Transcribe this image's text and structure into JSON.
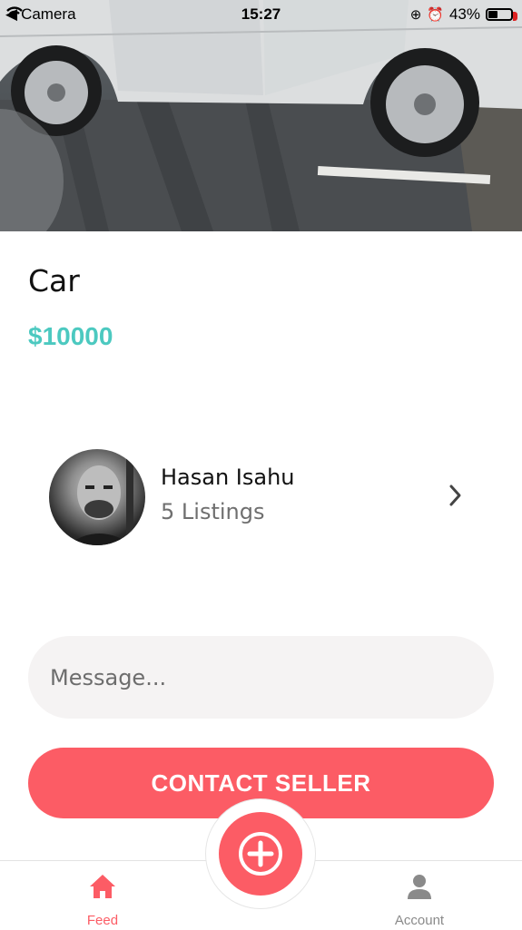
{
  "status_bar": {
    "back_app": "Camera",
    "time": "15:27",
    "battery": "43%"
  },
  "listing": {
    "title": "Car",
    "price": "$10000"
  },
  "seller": {
    "name": "Hasan Isahu",
    "listings": "5 Listings"
  },
  "message": {
    "placeholder": "Message..."
  },
  "contact_button": {
    "label": "CONTACT SELLER"
  },
  "tabbar": {
    "feed_label": "Feed",
    "account_label": "Account"
  },
  "colors": {
    "accent": "#fc5c65",
    "price": "#4cc9c0",
    "input_bg": "#f5f3f3"
  },
  "icons": {
    "feed": "home-icon",
    "account": "user-icon",
    "add": "plus-icon",
    "chevron": "chevron-right-icon"
  }
}
